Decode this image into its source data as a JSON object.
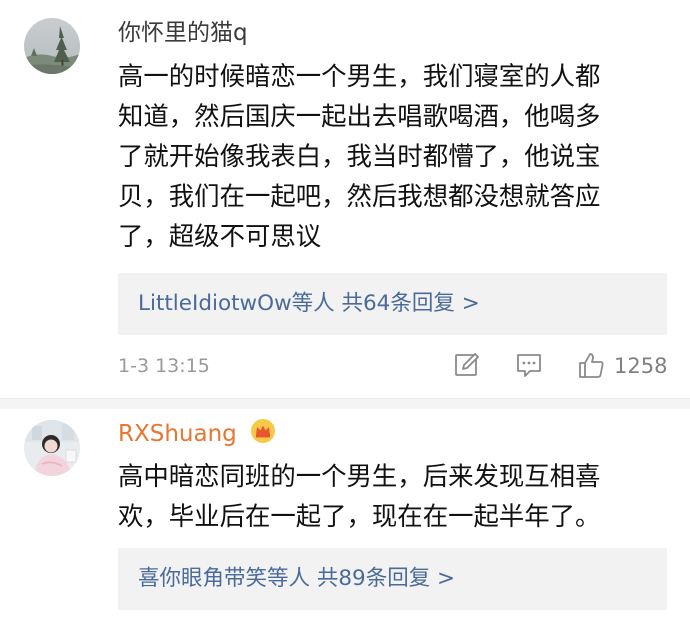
{
  "comments": [
    {
      "username": "你怀里的猫q",
      "avatar": "landscape-avatar",
      "text_lines": [
        "高一的时候暗恋一个男生，我们寝室的人都",
        "知道，然后国庆一起出去唱歌喝酒，他喝多",
        "了就开始像我表白，我当时都懵了，他说宝",
        "贝，我们在一起吧，然后我想都没想就答应",
        "了，超级不可思议"
      ],
      "replies": {
        "users": "LittleIdiotwOw等人",
        "count": "共64条回复 >"
      },
      "timestamp": "1-3 13:15",
      "actions": {
        "share_icon": "edit-share-icon",
        "comment_icon": "comment-icon",
        "like_icon": "thumbs-up-icon",
        "like_count": "1258"
      }
    },
    {
      "username": "RXShuang",
      "avatar": "person-avatar",
      "badge_icon": "crown-icon",
      "text_lines": [
        "高中暗恋同班的一个男生，后来发现互相喜",
        "欢，毕业后在一起了，现在在一起半年了。"
      ],
      "replies": {
        "users": "喜你眼角带笑等人",
        "count": "共89条回复 >"
      }
    }
  ],
  "colors": {
    "link_blue": "#4a6b9a",
    "vip_orange": "#e87530",
    "text_dark": "#111111",
    "meta_gray": "#9a9a9a",
    "reply_bg": "#f2f2f2"
  }
}
